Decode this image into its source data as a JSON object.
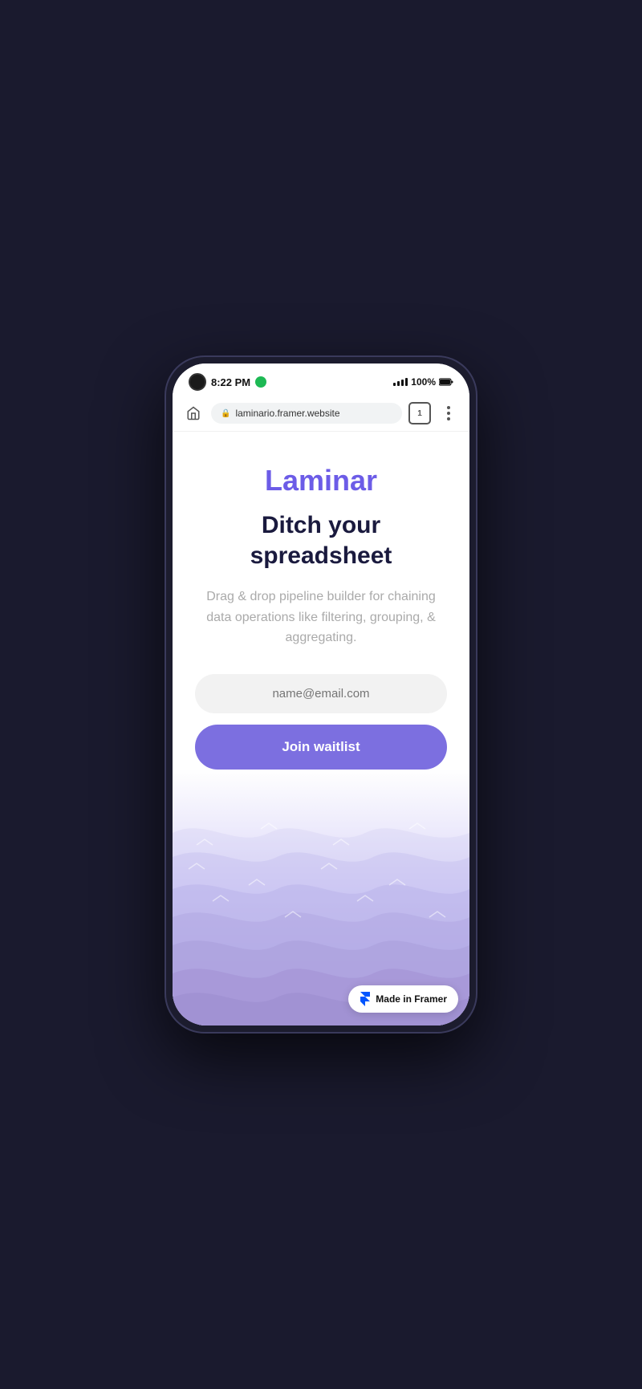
{
  "phone": {
    "status_bar": {
      "time": "8:22 PM",
      "battery_percent": "100%",
      "tab_count": "1"
    },
    "browser": {
      "url": "laminario.framer.website",
      "tab_label": "1"
    }
  },
  "page": {
    "app_name": "Laminar",
    "headline_line1": "Ditch your",
    "headline_line2": "spreadsheet",
    "subtext": "Drag & drop pipeline builder for chaining data operations like filtering, grouping, & aggregating.",
    "email_placeholder": "name@email.com",
    "cta_button": "Join waitlist",
    "framer_badge": "Made in Framer"
  },
  "colors": {
    "brand_purple": "#6c5ce7",
    "button_purple": "#7c6fe0",
    "headline_dark": "#1a1a3e",
    "subtext_gray": "#aaaaaa",
    "wave_purple": "#c9c2f5"
  }
}
